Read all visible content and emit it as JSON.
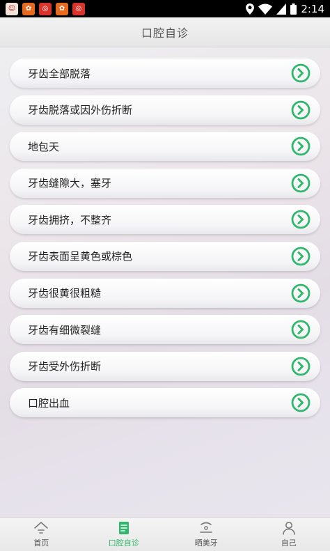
{
  "status_bar": {
    "time": "2:14",
    "notification_icons": [
      "app-icon",
      "app-icon",
      "app-icon",
      "app-icon",
      "app-icon"
    ]
  },
  "header": {
    "title": "口腔自诊"
  },
  "list": {
    "items": [
      {
        "label": "牙齿全部脱落"
      },
      {
        "label": "牙齿脱落或因外伤折断"
      },
      {
        "label": "地包天"
      },
      {
        "label": "牙齿缝隙大，塞牙"
      },
      {
        "label": "牙齿拥挤，不整齐"
      },
      {
        "label": "牙齿表面呈黄色或棕色"
      },
      {
        "label": "牙齿很黄很粗糙"
      },
      {
        "label": "牙齿有细微裂缝"
      },
      {
        "label": "牙齿受外伤折断"
      },
      {
        "label": "口腔出血"
      }
    ]
  },
  "tabbar": {
    "tabs": [
      {
        "label": "首页",
        "icon": "home-icon"
      },
      {
        "label": "口腔自诊",
        "icon": "clipboard-icon",
        "active": true
      },
      {
        "label": "晒美牙",
        "icon": "smile-icon"
      },
      {
        "label": "自己",
        "icon": "user-icon"
      }
    ]
  },
  "colors": {
    "accent": "#2fb86c",
    "title_text": "#555555"
  }
}
